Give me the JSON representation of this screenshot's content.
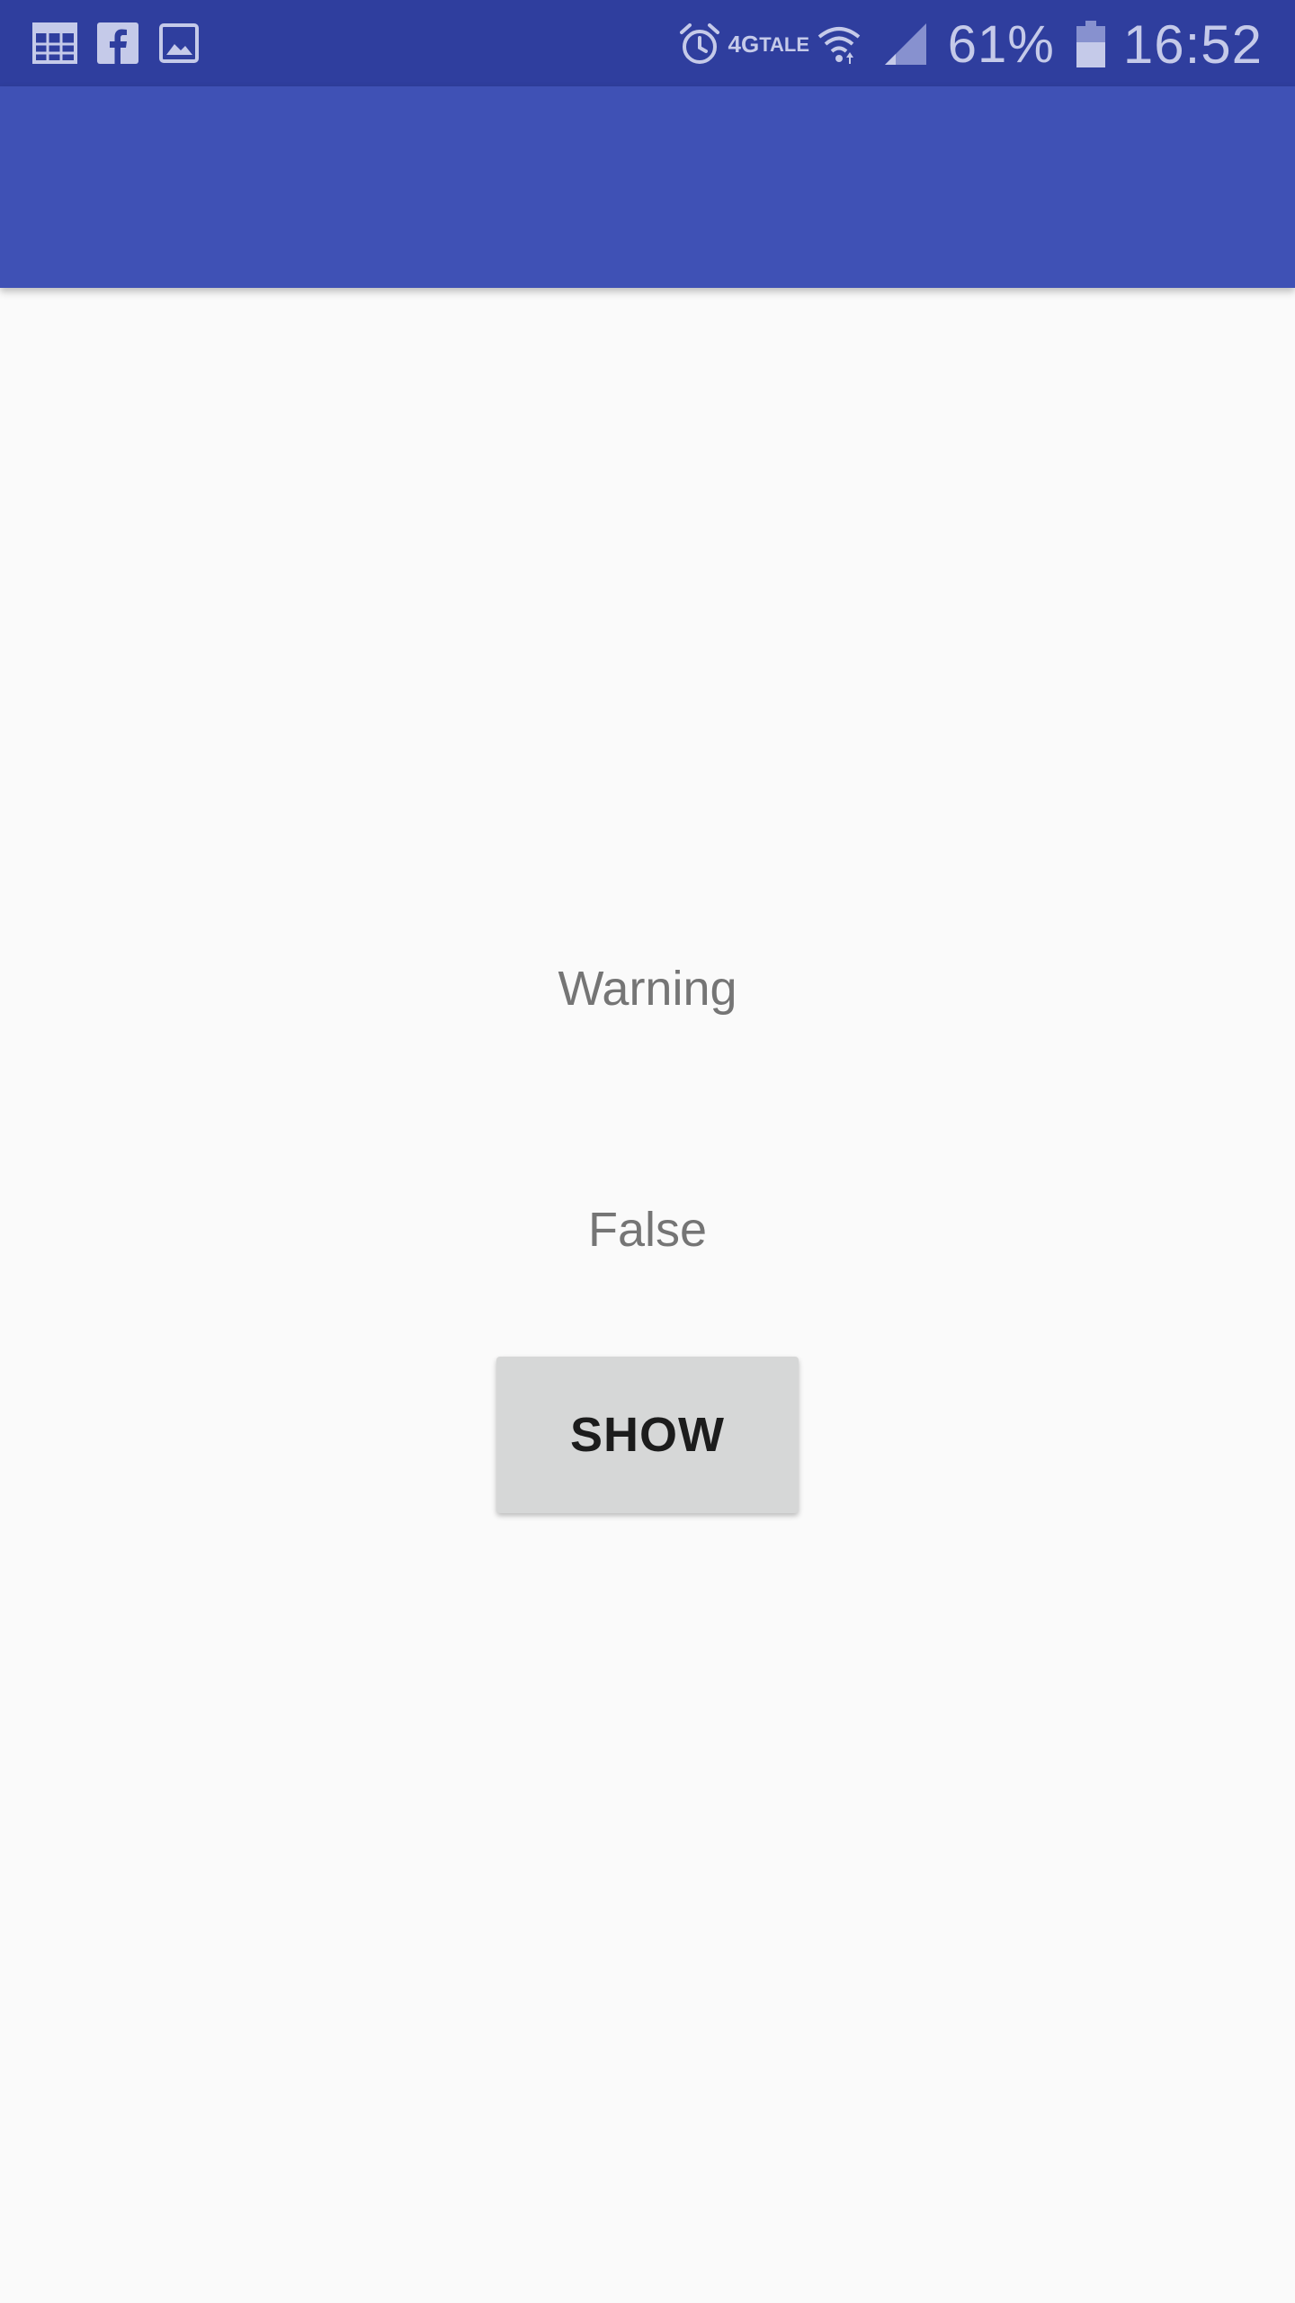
{
  "status_bar": {
    "notification_icons": [
      "calendar-icon",
      "facebook-icon",
      "gallery-icon"
    ],
    "network_label_top": "4G",
    "network_label_bottom": "TALE",
    "system_icons": [
      "alarm-icon",
      "wifi-icon",
      "signal-icon",
      "battery-icon"
    ],
    "battery_percent": "61%",
    "time": "16:52"
  },
  "app_bar": {
    "title": ""
  },
  "content": {
    "warning_text": "Warning",
    "value_text": "False",
    "show_button_label": "SHOW"
  },
  "colors": {
    "status_bar": "#2f3e9e",
    "app_bar": "#3f51b5",
    "background": "#fafafa",
    "text_secondary": "#757575",
    "button_background": "#d6d7d7"
  }
}
